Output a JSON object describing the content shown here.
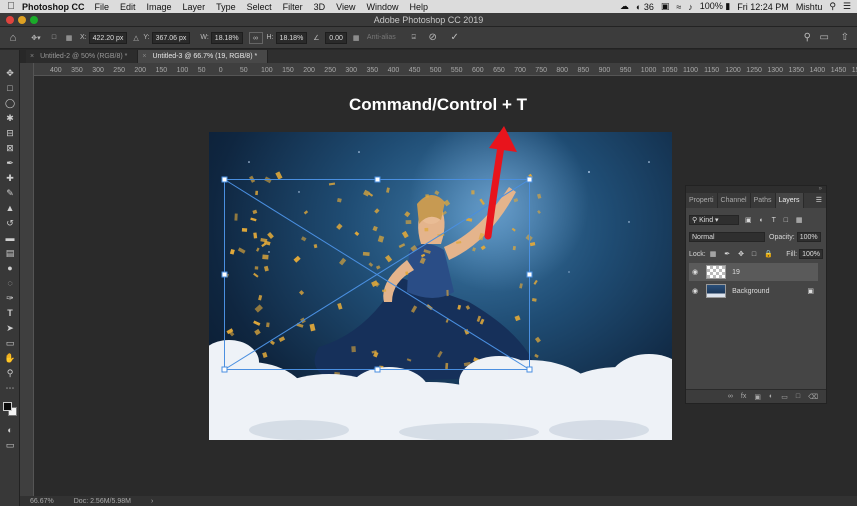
{
  "menubar": {
    "apple": "",
    "app_name": "Photoshop CC",
    "items": [
      "File",
      "Edit",
      "Image",
      "Layer",
      "Type",
      "Select",
      "Filter",
      "3D",
      "View",
      "Window",
      "Help"
    ],
    "badge": "36",
    "battery": "100%",
    "clock": "Fri 12:24 PM",
    "user": "Mishtu"
  },
  "window": {
    "title": "Adobe Photoshop CC 2019"
  },
  "options": {
    "x_label": "X:",
    "x_value": "422.20 px",
    "y_label": "Y:",
    "y_value": "367.06 px",
    "w_label": "W:",
    "w_value": "18.18%",
    "h_label": "H:",
    "h_value": "18.18%",
    "angle_value": "0.00",
    "antialias_label": "Anti-alias"
  },
  "tabs": [
    {
      "label": "Untitled-2 @ 50% (RGB/8) *"
    },
    {
      "label": "Untitled-3 @ 66.7% (19, RGB/8) *"
    }
  ],
  "ruler": {
    "ticks": [
      "400",
      "350",
      "300",
      "250",
      "200",
      "150",
      "100",
      "50",
      "0",
      "50",
      "100",
      "150",
      "200",
      "250",
      "300",
      "350",
      "400",
      "450",
      "500",
      "550",
      "600",
      "650",
      "700",
      "750",
      "800",
      "850",
      "900",
      "950",
      "1000",
      "1050",
      "1100",
      "1150",
      "1200",
      "1250",
      "1300",
      "1350",
      "1400",
      "1450",
      "1500",
      "1550"
    ]
  },
  "canvas": {
    "annotation": "Command/Control + T"
  },
  "layers_panel": {
    "tabs": [
      "Properti",
      "Channel",
      "Paths",
      "Layers"
    ],
    "filter_label": "Kind",
    "blend_mode": "Normal",
    "opacity_label": "Opacity:",
    "opacity_value": "100%",
    "lock_label": "Lock:",
    "fill_label": "Fill:",
    "fill_value": "100%",
    "layers": [
      {
        "name": "19"
      },
      {
        "name": "Background"
      }
    ]
  },
  "status": {
    "zoom": "66.67%",
    "doc": "Doc: 2.56M/5.98M"
  },
  "colors": {
    "accent_red": "#e8141c",
    "transform_box": "#4a8fe0",
    "confetti": "#e0a83a"
  }
}
